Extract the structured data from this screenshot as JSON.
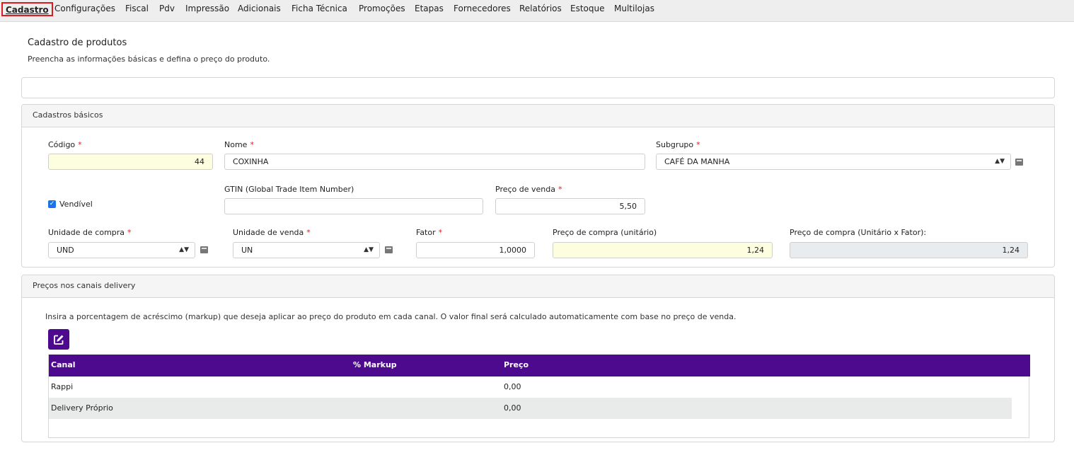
{
  "nav": {
    "tabs": [
      "Cadastro",
      "Configurações",
      "Fiscal",
      "Pdv",
      "Impressão",
      "Adicionais",
      "Ficha Técnica",
      "Promoções",
      "Etapas",
      "Fornecedores",
      "Relatórios",
      "Estoque",
      "Multilojas"
    ],
    "active": "Cadastro"
  },
  "page": {
    "title": "Cadastro de produtos",
    "subtitle": "Preencha as informações básicas e defina o preço do produto."
  },
  "basic": {
    "header": "Cadastros básicos",
    "codigo": {
      "label": "Código",
      "required": "*",
      "value": "44"
    },
    "nome": {
      "label": "Nome",
      "required": "*",
      "value": "COXINHA"
    },
    "subgrupo": {
      "label": "Subgrupo",
      "required": "*",
      "value": "CAFÉ DA MANHA"
    },
    "vendivel": {
      "label": "Vendível",
      "checked": true
    },
    "gtin": {
      "label": "GTIN (Global Trade Item Number)",
      "value": ""
    },
    "preco_venda": {
      "label": "Preço de venda",
      "required": "*",
      "value": "5,50"
    },
    "unidade_compra": {
      "label": "Unidade de compra",
      "required": "*",
      "value": "UND"
    },
    "unidade_venda": {
      "label": "Unidade de venda",
      "required": "*",
      "value": "UN"
    },
    "fator": {
      "label": "Fator",
      "required": "*",
      "value": "1,0000"
    },
    "preco_compra_unit": {
      "label": "Preço de compra (unitário)",
      "value": "1,24"
    },
    "preco_compra_total": {
      "label": "Preço de compra (Unitário x Fator):",
      "value": "1,24"
    }
  },
  "delivery": {
    "header": "Preços nos canais delivery",
    "description": "Insira a porcentagem de acréscimo (markup) que deseja aplicar ao preço do produto em cada canal. O valor final será calculado automaticamente com base no preço de venda.",
    "columns": {
      "canal": "Canal",
      "markup": "% Markup",
      "preco": "Preço"
    },
    "rows": [
      {
        "canal": "Rappi",
        "markup": "",
        "preco": "0,00"
      },
      {
        "canal": "Delivery Próprio",
        "markup": "",
        "preco": "0,00"
      }
    ]
  },
  "colors": {
    "accent": "#4e0a8e",
    "active_tab_border": "#e0191e",
    "highlight_input": "#fdfde0"
  },
  "icons": [
    "calculator-icon",
    "edit-icon",
    "select-arrows-icon",
    "checkbox-checked-icon"
  ]
}
